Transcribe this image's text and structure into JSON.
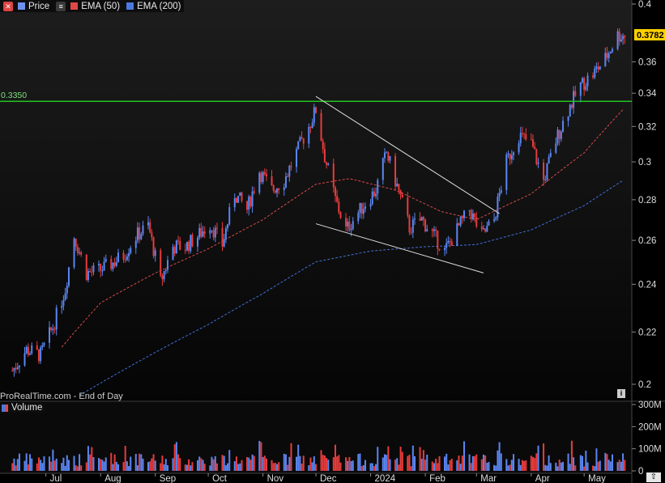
{
  "legend": {
    "price_label": "Price",
    "ema50_label": "EMA (50)",
    "ema200_label": "EMA (200)",
    "volume_label": "Volume"
  },
  "watermark": "ProRealTime.com - End of Day",
  "info_icon": "i",
  "colors": {
    "up": "#5b86f2",
    "down": "#e83c3c",
    "ema50": "#d84a4a",
    "ema200": "#3f6fd8",
    "resistance": "#22c322",
    "trendline": "#dddddd",
    "last_price_bg": "#ffd000"
  },
  "chart_data": {
    "type": "candlestick",
    "y_axis": {
      "ticks": [
        0.2,
        0.22,
        0.24,
        0.26,
        0.28,
        0.3,
        0.32,
        0.34,
        0.36,
        0.4
      ],
      "labels": [
        "0.2",
        "0.22",
        "0.24",
        "0.26",
        "0.28",
        "0.3",
        "0.32",
        "0.34",
        "0.36",
        "0.4"
      ],
      "scale": "log"
    },
    "volume_axis": {
      "ticks": [
        "300M",
        "200M",
        "100M",
        "0"
      ]
    },
    "x_axis": {
      "labels": [
        "Jul",
        "Aug",
        "Sep",
        "Oct",
        "Nov",
        "Dec",
        "2024",
        "Feb",
        "Mar",
        "Apr",
        "May"
      ]
    },
    "last_price": "0.3782",
    "resistance": {
      "value": 0.335,
      "label": "0.3350"
    },
    "price_anchors": [
      [
        "2023-06-12",
        0.205
      ],
      [
        "2023-06-20",
        0.213
      ],
      [
        "2023-06-28",
        0.211
      ],
      [
        "2023-07-05",
        0.222
      ],
      [
        "2023-07-12",
        0.238
      ],
      [
        "2023-07-17",
        0.262
      ],
      [
        "2023-07-24",
        0.245
      ],
      [
        "2023-07-31",
        0.246
      ],
      [
        "2023-08-07",
        0.249
      ],
      [
        "2023-08-14",
        0.253
      ],
      [
        "2023-08-21",
        0.262
      ],
      [
        "2023-08-28",
        0.267
      ],
      [
        "2023-09-04",
        0.241
      ],
      [
        "2023-09-11",
        0.257
      ],
      [
        "2023-09-18",
        0.257
      ],
      [
        "2023-09-25",
        0.262
      ],
      [
        "2023-10-02",
        0.268
      ],
      [
        "2023-10-09",
        0.258
      ],
      [
        "2023-10-16",
        0.283
      ],
      [
        "2023-10-23",
        0.275
      ],
      [
        "2023-10-30",
        0.295
      ],
      [
        "2023-11-06",
        0.285
      ],
      [
        "2023-11-13",
        0.29
      ],
      [
        "2023-11-20",
        0.305
      ],
      [
        "2023-11-27",
        0.32
      ],
      [
        "2023-12-01",
        0.33
      ],
      [
        "2023-12-06",
        0.303
      ],
      [
        "2023-12-12",
        0.28
      ],
      [
        "2023-12-18",
        0.265
      ],
      [
        "2023-12-27",
        0.276
      ],
      [
        "2024-01-04",
        0.285
      ],
      [
        "2024-01-10",
        0.305
      ],
      [
        "2024-01-16",
        0.287
      ],
      [
        "2024-01-23",
        0.266
      ],
      [
        "2024-01-30",
        0.27
      ],
      [
        "2024-02-06",
        0.262
      ],
      [
        "2024-02-12",
        0.255
      ],
      [
        "2024-02-19",
        0.265
      ],
      [
        "2024-02-26",
        0.275
      ],
      [
        "2024-03-04",
        0.262
      ],
      [
        "2024-03-11",
        0.27
      ],
      [
        "2024-03-18",
        0.3
      ],
      [
        "2024-03-25",
        0.315
      ],
      [
        "2024-04-01",
        0.31
      ],
      [
        "2024-04-08",
        0.29
      ],
      [
        "2024-04-15",
        0.312
      ],
      [
        "2024-04-22",
        0.33
      ],
      [
        "2024-04-29",
        0.345
      ],
      [
        "2024-05-06",
        0.352
      ],
      [
        "2024-05-13",
        0.362
      ],
      [
        "2024-05-20",
        0.378
      ]
    ],
    "ema50_anchors": [
      [
        "2023-07-10",
        0.214
      ],
      [
        "2023-08-01",
        0.232
      ],
      [
        "2023-09-01",
        0.245
      ],
      [
        "2023-10-01",
        0.256
      ],
      [
        "2023-11-01",
        0.27
      ],
      [
        "2023-12-01",
        0.288
      ],
      [
        "2023-12-20",
        0.291
      ],
      [
        "2024-01-15",
        0.285
      ],
      [
        "2024-02-10",
        0.274
      ],
      [
        "2024-03-01",
        0.27
      ],
      [
        "2024-04-01",
        0.283
      ],
      [
        "2024-05-01",
        0.305
      ],
      [
        "2024-05-23",
        0.33
      ]
    ],
    "ema200_anchors": [
      [
        "2023-07-20",
        0.196
      ],
      [
        "2023-09-01",
        0.212
      ],
      [
        "2023-10-01",
        0.223
      ],
      [
        "2023-11-01",
        0.236
      ],
      [
        "2023-12-01",
        0.25
      ],
      [
        "2024-01-01",
        0.255
      ],
      [
        "2024-02-01",
        0.257
      ],
      [
        "2024-03-01",
        0.258
      ],
      [
        "2024-04-01",
        0.265
      ],
      [
        "2024-05-01",
        0.277
      ],
      [
        "2024-05-23",
        0.29
      ]
    ],
    "trendlines": [
      {
        "from": [
          "2023-12-01",
          0.338
        ],
        "to": [
          "2024-03-14",
          0.273
        ]
      },
      {
        "from": [
          "2023-12-01",
          0.268
        ],
        "to": [
          "2024-03-05",
          0.245
        ]
      }
    ]
  }
}
